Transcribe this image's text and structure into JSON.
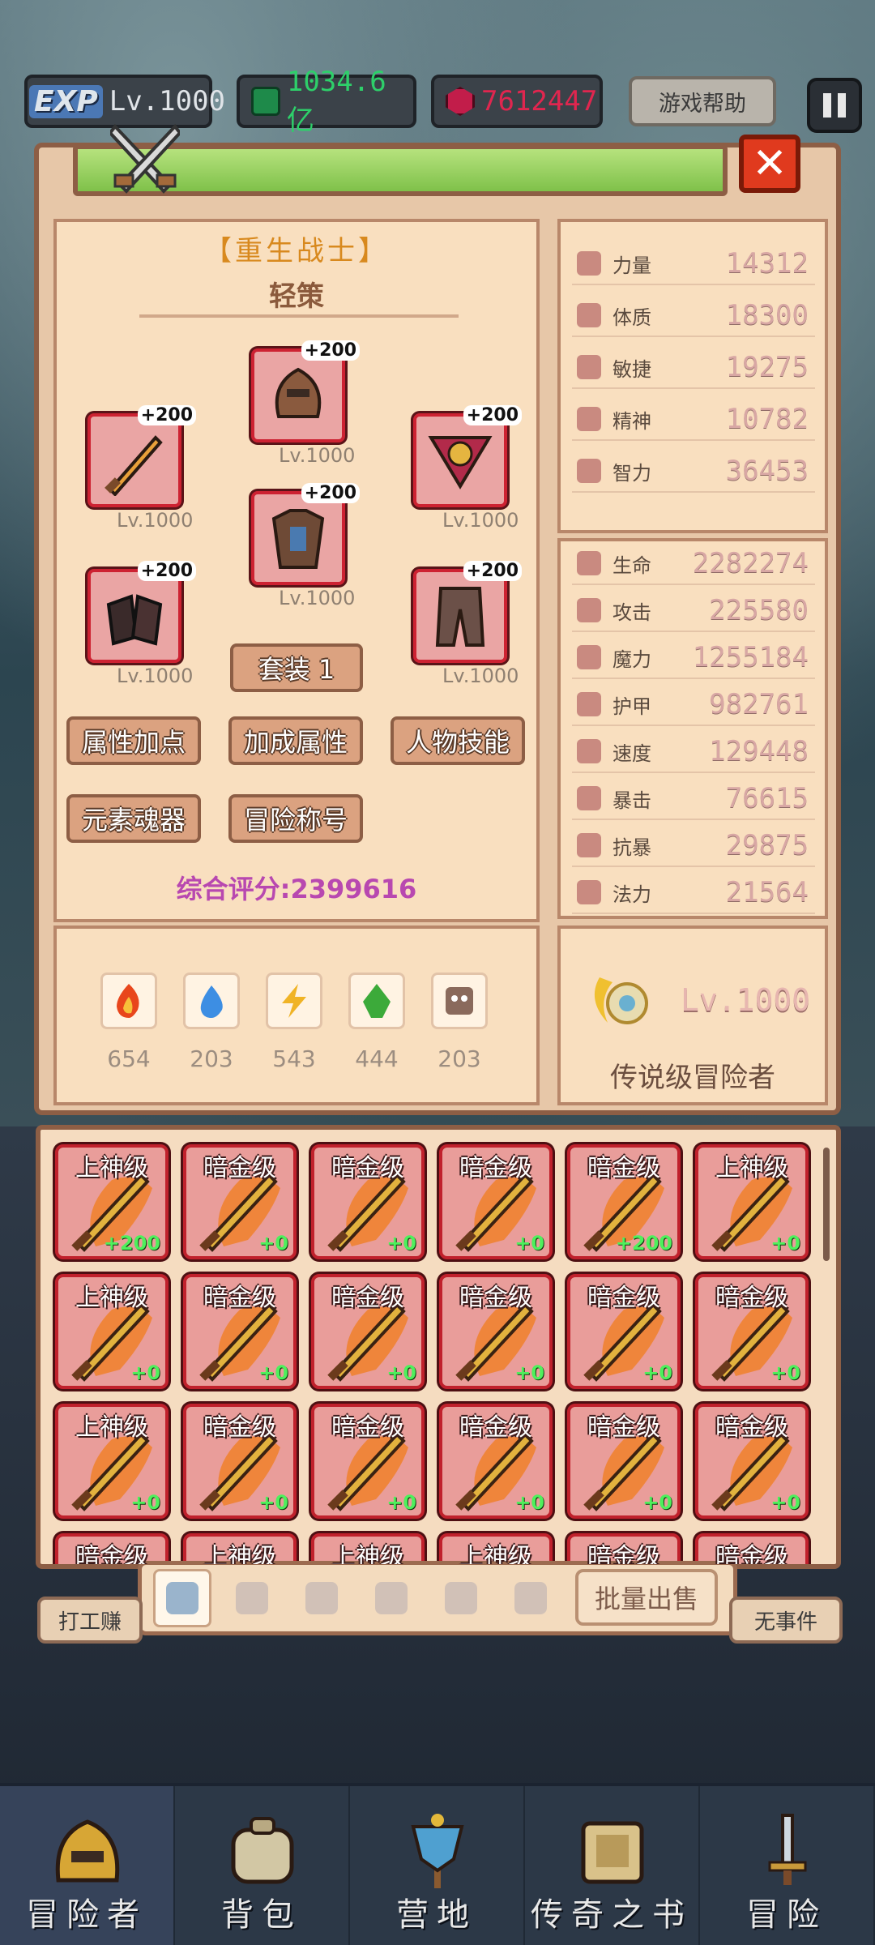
{
  "hud": {
    "exp_badge": "EXP",
    "level": "Lv.1000",
    "gems": "1034.6亿",
    "rubies": "7612447",
    "help_label": "游戏帮助"
  },
  "character": {
    "class_title": "【重生战士】",
    "name": "轻策",
    "slots": [
      {
        "plus": "+200",
        "level": "Lv.1000",
        "icon": "helmet-icon"
      },
      {
        "plus": "+200",
        "level": "Lv.1000",
        "icon": "sword-icon"
      },
      {
        "plus": "+200",
        "level": "Lv.1000",
        "icon": "amulet-icon"
      },
      {
        "plus": "+200",
        "level": "Lv.1000",
        "icon": "armor-icon"
      },
      {
        "plus": "+200",
        "level": "Lv.1000",
        "icon": "gloves-icon"
      },
      {
        "plus": "+200",
        "level": "Lv.1000",
        "icon": "pants-icon"
      }
    ],
    "set_button": "套装 1",
    "buttons": [
      "属性加点",
      "加成属性",
      "人物技能",
      "元素魂器",
      "冒险称号"
    ],
    "score": "综合评分:2399616"
  },
  "base_stats": [
    {
      "label": "力量",
      "value": "14312",
      "icon": "strength-icon"
    },
    {
      "label": "体质",
      "value": "18300",
      "icon": "heart-icon"
    },
    {
      "label": "敏捷",
      "value": "19275",
      "icon": "boot-icon"
    },
    {
      "label": "精神",
      "value": "10782",
      "icon": "star-icon"
    },
    {
      "label": "智力",
      "value": "36453",
      "icon": "brain-icon"
    }
  ],
  "combat_stats": [
    {
      "label": "生命",
      "value": "2282274",
      "icon": "heart-icon"
    },
    {
      "label": "攻击",
      "value": "225580",
      "icon": "sword-icon"
    },
    {
      "label": "魔力",
      "value": "1255184",
      "icon": "wand-icon"
    },
    {
      "label": "护甲",
      "value": "982761",
      "icon": "shield-icon"
    },
    {
      "label": "速度",
      "value": "129448",
      "icon": "boot-icon"
    },
    {
      "label": "暴击",
      "value": "76615",
      "icon": "crit-icon"
    },
    {
      "label": "抗暴",
      "value": "29875",
      "icon": "crit-resist-icon"
    },
    {
      "label": "法力",
      "value": "21564",
      "icon": "star-icon"
    }
  ],
  "elements": [
    {
      "value": "654",
      "icon": "fire-icon",
      "color": "#e8461c"
    },
    {
      "value": "203",
      "icon": "water-icon",
      "color": "#3d8ee3"
    },
    {
      "value": "543",
      "icon": "lightning-icon",
      "color": "#f0b325"
    },
    {
      "value": "444",
      "icon": "earth-icon",
      "color": "#3caa3a"
    },
    {
      "value": "203",
      "icon": "dark-icon",
      "color": "#8a6a5c"
    }
  ],
  "rank": {
    "level": "Lv.1000",
    "title": "传说级冒险者"
  },
  "inventory": [
    {
      "grade": "上神级",
      "enh": "+200"
    },
    {
      "grade": "暗金级",
      "enh": "+0"
    },
    {
      "grade": "暗金级",
      "enh": "+0"
    },
    {
      "grade": "暗金级",
      "enh": "+0"
    },
    {
      "grade": "暗金级",
      "enh": "+200"
    },
    {
      "grade": "上神级",
      "enh": "+0"
    },
    {
      "grade": "上神级",
      "enh": "+0"
    },
    {
      "grade": "暗金级",
      "enh": "+0"
    },
    {
      "grade": "暗金级",
      "enh": "+0"
    },
    {
      "grade": "暗金级",
      "enh": "+0"
    },
    {
      "grade": "暗金级",
      "enh": "+0"
    },
    {
      "grade": "暗金级",
      "enh": "+0"
    },
    {
      "grade": "上神级",
      "enh": "+0"
    },
    {
      "grade": "暗金级",
      "enh": "+0"
    },
    {
      "grade": "暗金级",
      "enh": "+0"
    },
    {
      "grade": "暗金级",
      "enh": "+0"
    },
    {
      "grade": "暗金级",
      "enh": "+0"
    },
    {
      "grade": "暗金级",
      "enh": "+0"
    },
    {
      "grade": "暗金级",
      "enh": ""
    },
    {
      "grade": "上神级",
      "enh": ""
    },
    {
      "grade": "上神级",
      "enh": ""
    },
    {
      "grade": "上神级",
      "enh": ""
    },
    {
      "grade": "暗金级",
      "enh": ""
    },
    {
      "grade": "暗金级",
      "enh": ""
    }
  ],
  "inventory_tabs": [
    "weapon-tab-icon",
    "armor-tab-icon",
    "helmet-tab-icon",
    "accessory-tab-icon",
    "gear-tab-icon",
    "ring-tab-icon"
  ],
  "bulk_sell": "批量出售",
  "side_left": "打工赚",
  "side_right": "无事件",
  "nav": [
    {
      "label": "冒险者",
      "icon": "helmet-icon"
    },
    {
      "label": "背包",
      "icon": "backpack-icon"
    },
    {
      "label": "营地",
      "icon": "camp-banner-icon"
    },
    {
      "label": "传奇之书",
      "icon": "book-icon"
    },
    {
      "label": "冒险",
      "icon": "sword-icon"
    }
  ]
}
